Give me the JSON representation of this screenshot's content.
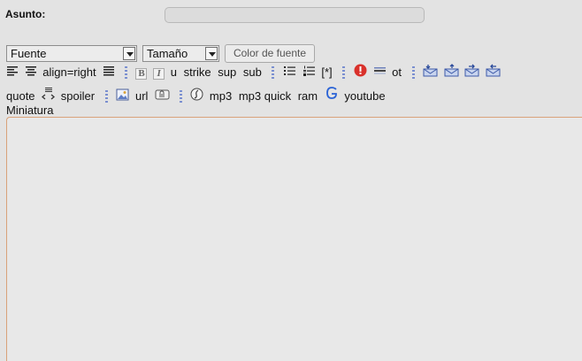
{
  "form": {
    "subject_label": "Asunto:",
    "subject_value": ""
  },
  "toolbar": {
    "font_select": "Fuente",
    "size_select": "Tamaño",
    "color_button": "Color de fuente",
    "align_right": "align=right",
    "underline": "u",
    "strike": "strike",
    "sup": "sup",
    "sub": "sub",
    "list_item": "[*]",
    "ot": "ot",
    "quote": "quote",
    "spoiler": "spoiler",
    "url": "url",
    "mp3": "mp3",
    "mp3_quick": "mp3 quick",
    "ram": "ram",
    "youtube": "youtube",
    "bold_glyph": "B",
    "italic_glyph": "I"
  },
  "thumbnail_label": "Miniatura",
  "editor_content": "",
  "icons": {
    "align-left": "align-left-icon",
    "align-center": "align-center-icon",
    "justify": "justify-icon",
    "bullet-list": "bullet-list-icon",
    "numbered-list": "numbered-list-icon",
    "warning": "warning-icon",
    "horizontal-rule": "horizontal-rule-icon",
    "mail": "mail-icon",
    "code": "code-icon",
    "image": "image-icon",
    "attachment": "attachment-icon",
    "flash": "flash-icon",
    "google": "google-icon"
  },
  "colors": {
    "background": "#e3e3e3",
    "editor_border": "#d9a27a",
    "separator": "#7a8fd0",
    "warning": "#d9312b",
    "google_blue": "#2a63d6"
  }
}
